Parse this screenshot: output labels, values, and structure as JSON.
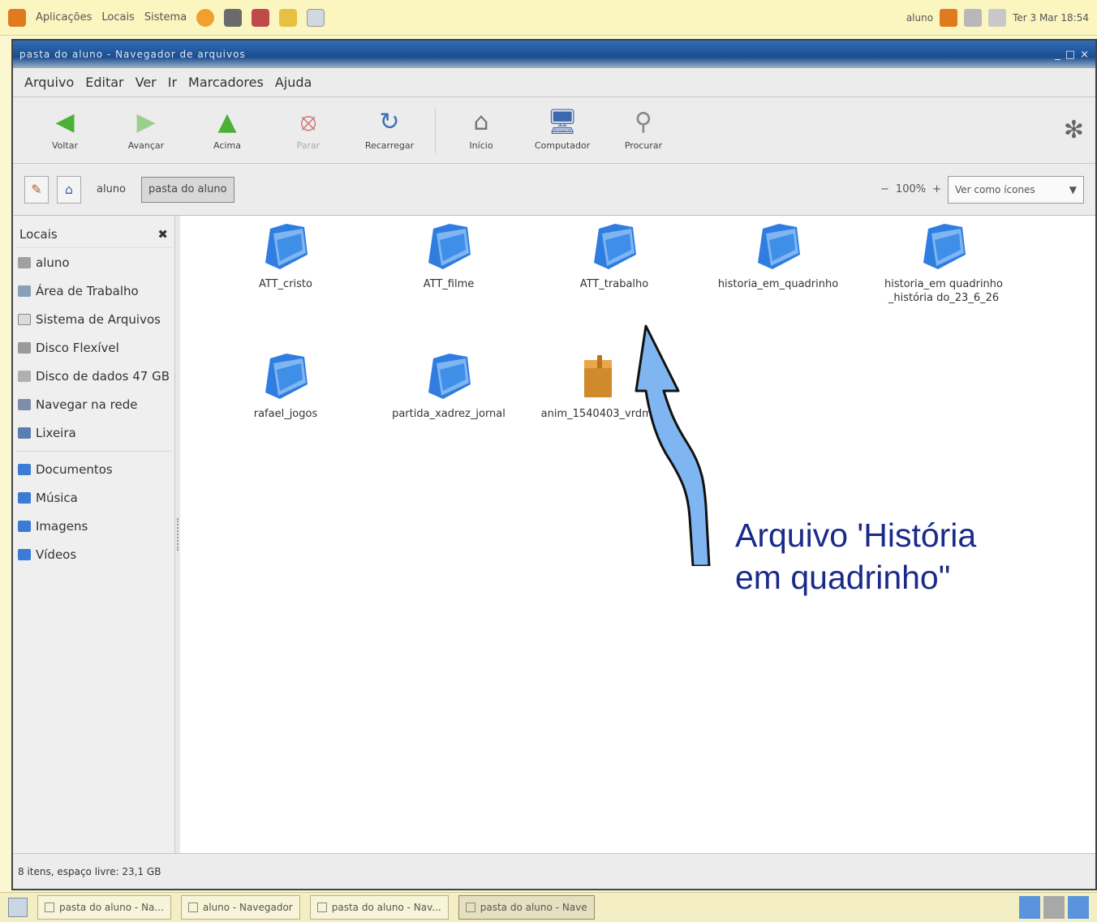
{
  "top_panel": {
    "menu_apps": "Aplicações",
    "menu_places": "Locais",
    "menu_system": "Sistema",
    "tray_user": "aluno",
    "tray_clock": "Ter 3 Mar 18:54"
  },
  "window": {
    "title": "pasta do aluno - Navegador de arquivos",
    "controls": [
      "_",
      "□",
      "×"
    ]
  },
  "menubar": [
    "Arquivo",
    "Editar",
    "Ver",
    "Ir",
    "Marcadores",
    "Ajuda"
  ],
  "toolbar": {
    "back": "Voltar",
    "forward": "Avançar",
    "up": "Acima",
    "stop": "Parar",
    "reload": "Recarregar",
    "home": "Início",
    "computer": "Computador",
    "search": "Procurar"
  },
  "locationbar": {
    "crumb_parent": "aluno",
    "crumb_current": "pasta do aluno",
    "zoom": "100%",
    "view_mode": "Ver como ícones"
  },
  "sidebar": {
    "header": "Locais",
    "items": [
      "aluno",
      "Área de Trabalho",
      "Sistema de Arquivos",
      "Disco Flexível",
      "Disco de dados 47 GB",
      "Navegar na rede",
      "Lixeira"
    ],
    "bookmarks": [
      "Documentos",
      "Música",
      "Imagens",
      "Vídeos"
    ]
  },
  "files": [
    {
      "name": "ATT_cristo",
      "type": "folder"
    },
    {
      "name": "ATT_filme",
      "type": "folder"
    },
    {
      "name": "ATT_trabalho",
      "type": "folder"
    },
    {
      "name": "historia_em_quadrinho",
      "type": "folder"
    },
    {
      "name": "historia_em quadrinho_história do_23_6_26",
      "type": "folder"
    },
    {
      "name": "rafael_jogos",
      "type": "folder"
    },
    {
      "name": "partida_xadrez_jornal",
      "type": "folder"
    },
    {
      "name": "anim_1540403_vrdml",
      "type": "file"
    }
  ],
  "annotation": {
    "line1": "Arquivo 'História",
    "line2": "em quadrinho\""
  },
  "statusbar": "8 itens, espaço livre: 23,1 GB",
  "taskbar": [
    "pasta do aluno - Na...",
    "aluno - Navegador",
    "pasta do aluno - Nav...",
    "pasta do aluno - Nave"
  ]
}
